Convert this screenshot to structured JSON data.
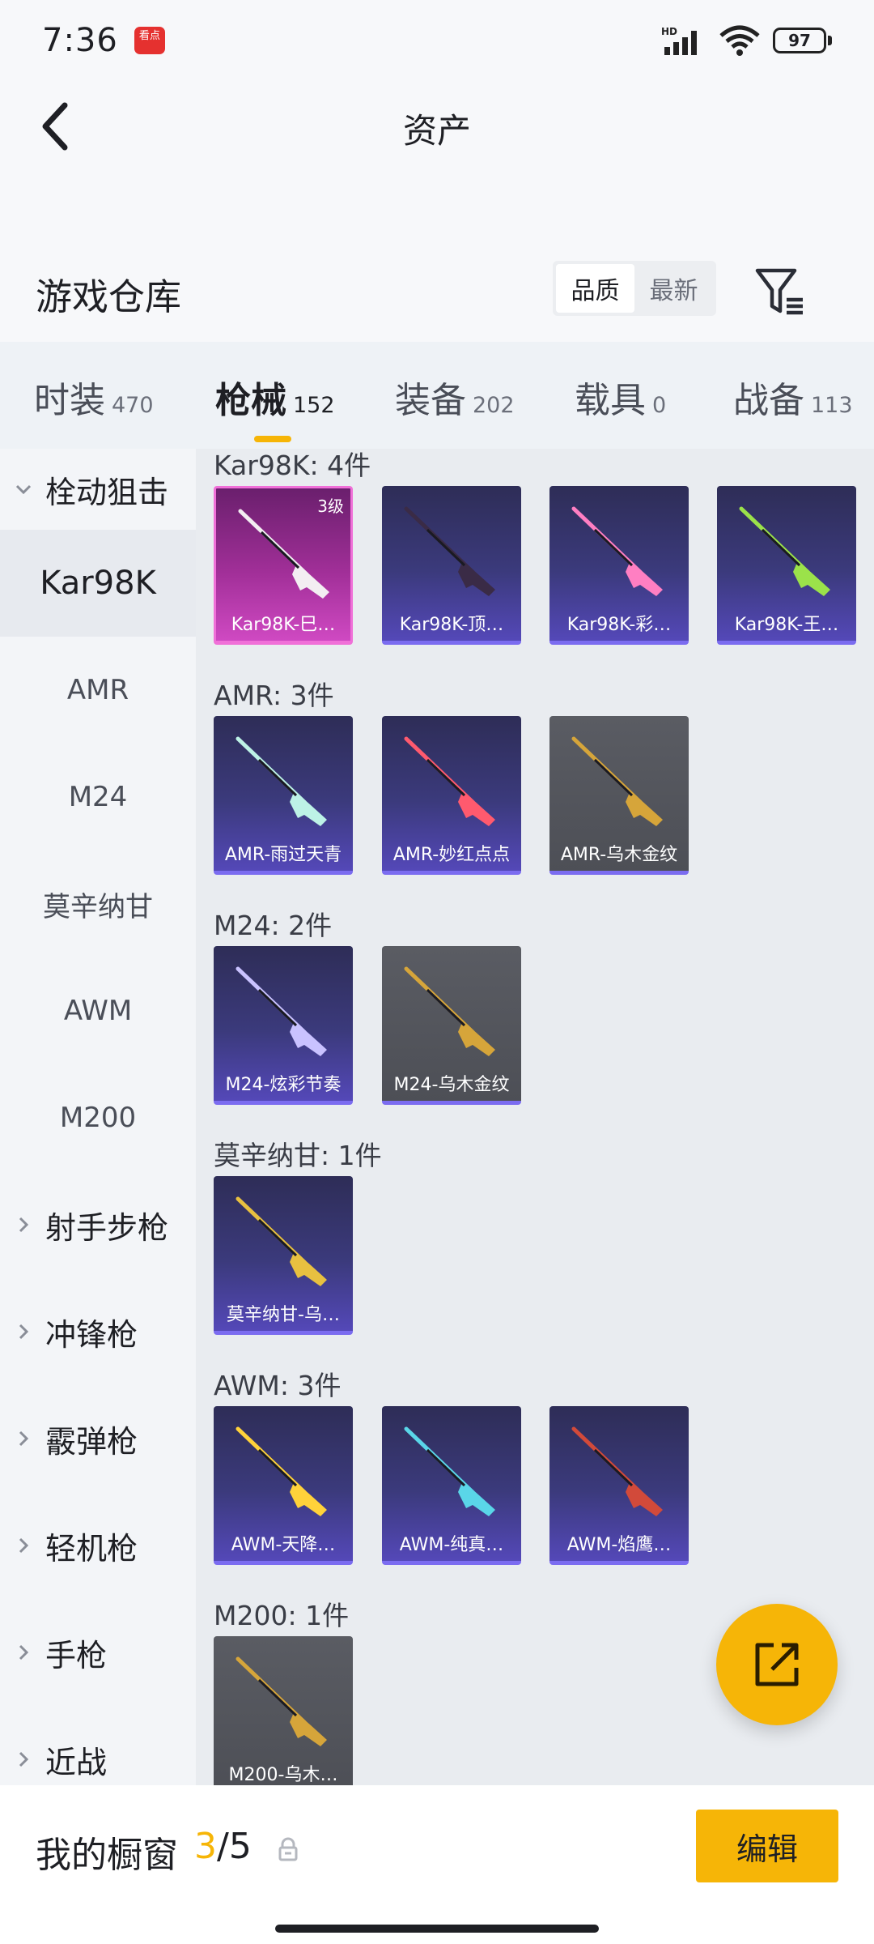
{
  "status_bar": {
    "time": "7:36",
    "app_badge": "看点",
    "network": "HD",
    "battery": "97"
  },
  "nav": {
    "title": "资产"
  },
  "warehouse": {
    "title": "游戏仓库",
    "sort_options": [
      "品质",
      "最新"
    ],
    "active_sort": "品质"
  },
  "tabs": [
    {
      "label": "时装",
      "count": "470"
    },
    {
      "label": "枪械",
      "count": "152",
      "active": true
    },
    {
      "label": "装备",
      "count": "202"
    },
    {
      "label": "载具",
      "count": "0"
    },
    {
      "label": "战备",
      "count": "113"
    }
  ],
  "sidebar": {
    "items": [
      {
        "label": "栓动狙击",
        "group": true,
        "expanded": true
      },
      {
        "label": "Kar98K",
        "active": true
      },
      {
        "label": "AMR"
      },
      {
        "label": "M24"
      },
      {
        "label": "莫辛纳甘"
      },
      {
        "label": "AWM"
      },
      {
        "label": "M200"
      },
      {
        "label": "射手步枪",
        "group": true
      },
      {
        "label": "冲锋枪",
        "group": true
      },
      {
        "label": "霰弹枪",
        "group": true
      },
      {
        "label": "轻机枪",
        "group": true
      },
      {
        "label": "手枪",
        "group": true
      },
      {
        "label": "近战",
        "group": true
      }
    ]
  },
  "sections": [
    {
      "title": "Kar98K: 4件",
      "items": [
        {
          "name": "Kar98K-巳…",
          "tier": "pink",
          "level": "3级",
          "color": "#f3eef2"
        },
        {
          "name": "Kar98K-顶…",
          "tier": "purple",
          "color": "#3a2b46"
        },
        {
          "name": "Kar98K-彩…",
          "tier": "purple",
          "color": "#ff7fc2"
        },
        {
          "name": "Kar98K-王…",
          "tier": "purple",
          "color": "#9be24a"
        }
      ]
    },
    {
      "title": "AMR: 3件",
      "items": [
        {
          "name": "AMR-雨过天青",
          "tier": "purple",
          "color": "#bdf2e6"
        },
        {
          "name": "AMR-妙红点点",
          "tier": "purple",
          "color": "#ff5a6e"
        },
        {
          "name": "AMR-乌木金纹",
          "tier": "grey",
          "color": "#d6a53a"
        }
      ]
    },
    {
      "title": "M24: 2件",
      "items": [
        {
          "name": "M24-炫彩节奏",
          "tier": "purple",
          "color": "#c9c2ff"
        },
        {
          "name": "M24-乌木金纹",
          "tier": "grey",
          "color": "#d6a53a"
        }
      ]
    },
    {
      "title": "莫辛纳甘: 1件",
      "items": [
        {
          "name": "莫辛纳甘-乌…",
          "tier": "purple",
          "color": "#e8c040"
        }
      ]
    },
    {
      "title": "AWM: 3件",
      "items": [
        {
          "name": "AWM-天降…",
          "tier": "purple",
          "color": "#ffd23a"
        },
        {
          "name": "AWM-纯真…",
          "tier": "purple",
          "color": "#5ad6e8"
        },
        {
          "name": "AWM-焰鹰…",
          "tier": "purple",
          "color": "#d24a3a"
        }
      ]
    },
    {
      "title": "M200: 1件",
      "items": [
        {
          "name": "M200-乌木…",
          "tier": "grey",
          "color": "#d6a53a"
        }
      ]
    }
  ],
  "showcase": {
    "label": "我的橱窗",
    "current": "3",
    "separator": "/",
    "total": "5",
    "edit_label": "编辑"
  },
  "colors": {
    "accent": "#f6b507",
    "purple_tier": "#5448b8",
    "pink_tier": "#cf49c2",
    "grey_tier": "#4d4f56"
  }
}
